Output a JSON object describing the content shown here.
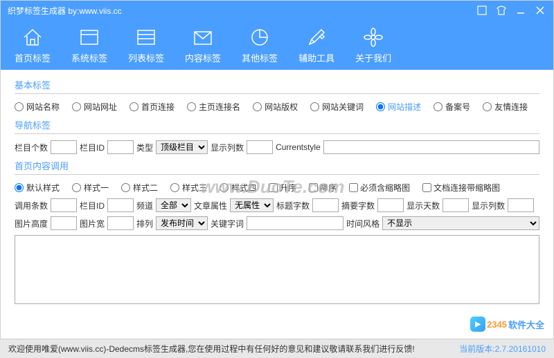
{
  "window": {
    "title": "织梦标签生成器  by:www.viis.cc"
  },
  "nav": [
    {
      "label": "首页标签"
    },
    {
      "label": "系统标签"
    },
    {
      "label": "列表标签"
    },
    {
      "label": "内容标签"
    },
    {
      "label": "其他标签"
    },
    {
      "label": "辅助工具"
    },
    {
      "label": "关于我们"
    }
  ],
  "sections": {
    "basic": "基本标签",
    "nav": "导航标签",
    "home": "首页内容调用"
  },
  "basic_radios": [
    "网站名称",
    "网站网址",
    "首页连接",
    "主页连接名",
    "网站版权",
    "网站关键词",
    "网站描述",
    "备案号",
    "友情连接"
  ],
  "nav_form": {
    "count_label": "栏目个数",
    "id_label": "栏目ID",
    "type_label": "类型",
    "type_value": "顶级栏目",
    "cols_label": "显示列数",
    "currentstyle_label": "Currentstyle"
  },
  "home_radios": [
    "默认样式",
    "样式一",
    "样式二",
    "样式三",
    "样式四"
  ],
  "home_checks": [
    "升序",
    "降序",
    "必须含缩略图",
    "文档连接带缩略图"
  ],
  "home_row1": {
    "count_label": "调用条数",
    "colid_label": "栏目ID",
    "channel_label": "频道",
    "channel_value": "全部",
    "attr_label": "文章属性",
    "attr_value": "无属性",
    "titlelen_label": "标题字数",
    "desclen_label": "摘要字数",
    "days_label": "显示天数",
    "cols_label": "显示列数"
  },
  "home_row2": {
    "imgh_label": "图片高度",
    "imgw_label": "图片宽",
    "sort_label": "排列",
    "sort_value": "发布时间",
    "keyword_label": "关键字词",
    "timefmt_label": "时间风格",
    "timefmt_value": "不显示"
  },
  "watermark": "www.DuoTe.com",
  "logo": {
    "a": "2345",
    "b": "软件大全"
  },
  "footer": {
    "message": "欢迎使用唯爱(www.viis.cc)-Dedecms标签生成器,您在使用过程中有任何好的意见和建议敬请联系我们进行反馈!",
    "version": "当前版本:2.7.20161010"
  }
}
